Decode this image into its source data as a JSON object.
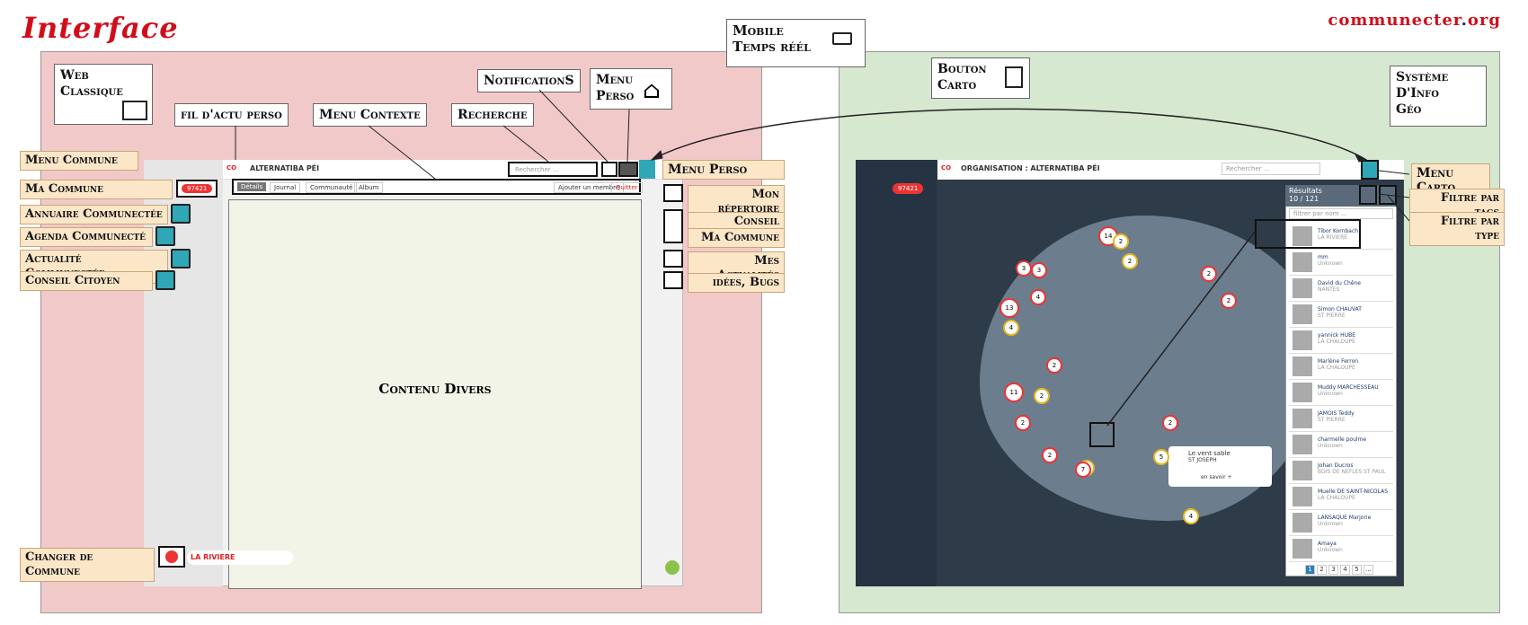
{
  "header": {
    "title": "Interface",
    "brand_a": "communecter",
    "brand_b": ".",
    "brand_c": "org"
  },
  "left": {
    "web_classique": "Web\nClassique",
    "fil_actu": "fil d'actu perso",
    "menu_contexte": "Menu Contexte",
    "recherche": "Recherche",
    "notifications": "NotificationS",
    "menu_perso_top": "Menu\nPerso",
    "menu_commune": "Menu Commune",
    "ma_commune": "Ma Commune",
    "annuaire": "Annuaire Communectée",
    "agenda": "Agenda Communecté",
    "actualite": "Actualité Communectée",
    "conseil": "Conseil Citoyen",
    "changer": "Changer de Commune",
    "changer_value": "LA RIVIERE",
    "commune_badge": "97421",
    "contenu": "Contenu Divers",
    "app_title": "ALTERNATIBA PÉI",
    "search_placeholder": "Rechercher ...",
    "tabs": [
      "Détails",
      "Journal",
      "Communauté",
      "Album"
    ],
    "add_member": "Ajouter un membre",
    "quit": "Quitter",
    "menu_perso": "Menu Perso",
    "perso_items": [
      "Mon répertoire",
      "Conseil Citoyen",
      "Ma Commune",
      "Mes Actualités",
      "idées, Bugs"
    ]
  },
  "center": {
    "mobile": "Mobile\nTemps réél"
  },
  "right": {
    "bouton_carto": "Bouton\nCarto",
    "systeme": "Système\nD'Info\nGéo",
    "menu_carto": "Menu Carto",
    "filtre_tags": "Filtre par tags",
    "filtre_type": "Filtre par type",
    "org_title": "ORGANISATION : ALTERNATIBA PÉI",
    "search_placeholder": "Rechercher ...",
    "badge": "97421",
    "results_title": "Résultats",
    "results_count": "10 / 121",
    "filter_placeholder": "filtrer par nom ...",
    "results": [
      {
        "name": "Tibor Kornbach",
        "place": "LA RIVIERE"
      },
      {
        "name": "mm",
        "place": "Unknown"
      },
      {
        "name": "David du Chêne",
        "place": "NANTES"
      },
      {
        "name": "Simon CHAUVAT",
        "place": "ST PIERRE"
      },
      {
        "name": "yannick HUBE",
        "place": "LA CHALOUPE"
      },
      {
        "name": "Marlène Ferron",
        "place": "LA CHALOUPE"
      },
      {
        "name": "Muddy MARCHESSEAU",
        "place": "Unknown"
      },
      {
        "name": "JAMOIS Teddy",
        "place": "ST PIERRE"
      },
      {
        "name": "charmelle poulme",
        "place": "Unknown"
      },
      {
        "name": "Johan Ducros",
        "place": "BOIS DE NEFLES ST PAUL"
      },
      {
        "name": "Muelle DE SAINT-NICOLAS",
        "place": "LA CHALOUPE"
      },
      {
        "name": "LANSAQUE Marjorie",
        "place": "Unknown"
      },
      {
        "name": "Amaya",
        "place": "Unknown"
      }
    ],
    "pages": [
      "1",
      "2",
      "3",
      "4",
      "5",
      "..."
    ],
    "popup_name": "Le vent sable",
    "popup_place": "ST JOSEPH",
    "popup_btn": "en savoir +",
    "clusters": [
      "14",
      "2",
      "3",
      "3",
      "2",
      "4",
      "13",
      "4",
      "2",
      "11",
      "2",
      "2",
      "2",
      "3",
      "7",
      "2",
      "5",
      "2",
      "2",
      "4"
    ]
  }
}
